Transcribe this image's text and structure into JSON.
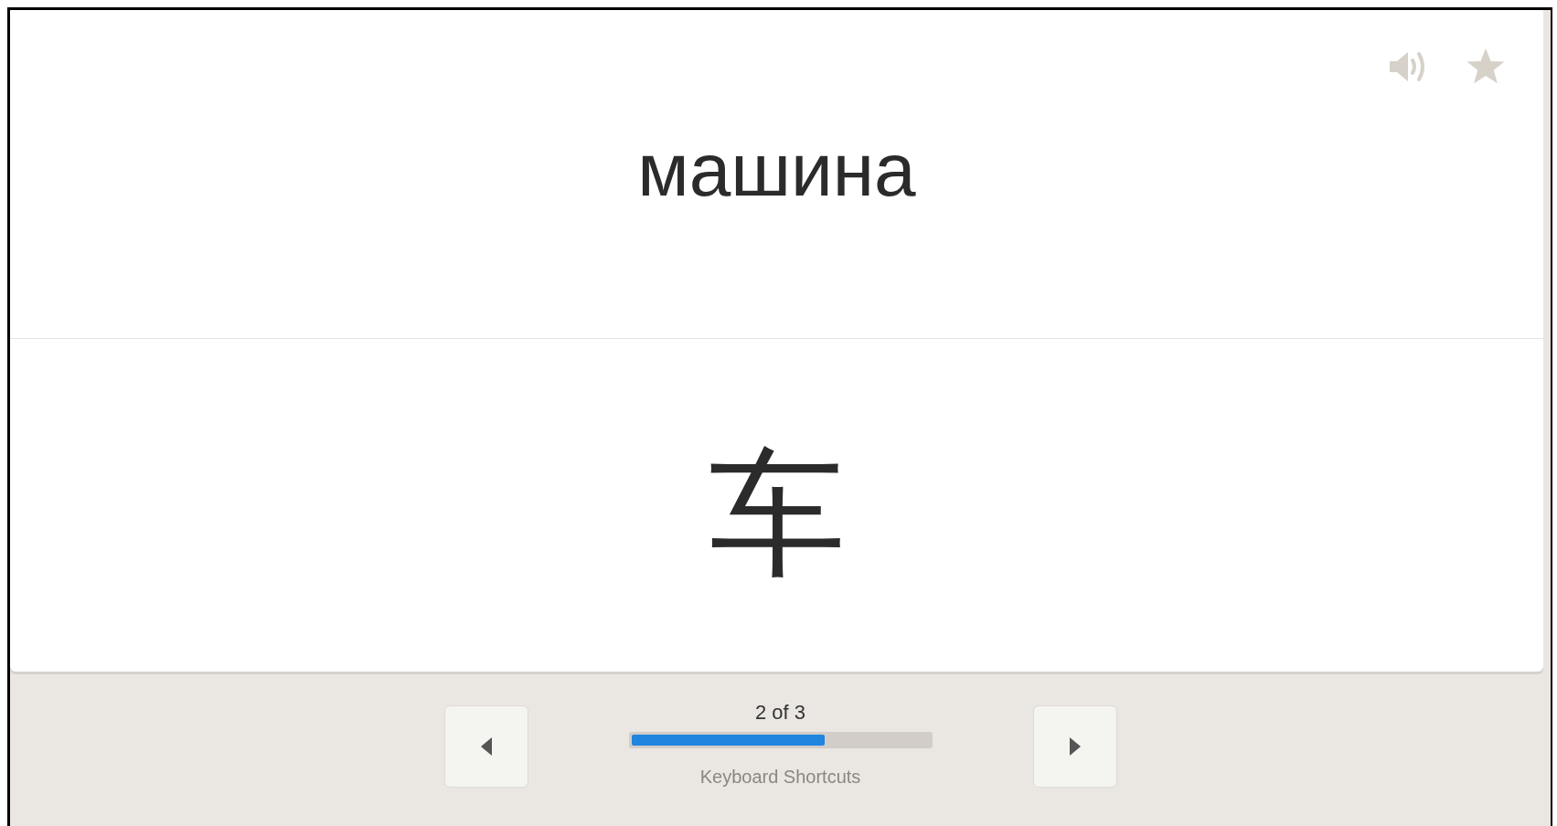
{
  "card": {
    "term": "машина",
    "definition": "车",
    "starred": false
  },
  "footer": {
    "counter": "2 of 3",
    "progress": {
      "level": 0.65
    },
    "shortcuts_link": "Keyboard Shortcuts"
  }
}
